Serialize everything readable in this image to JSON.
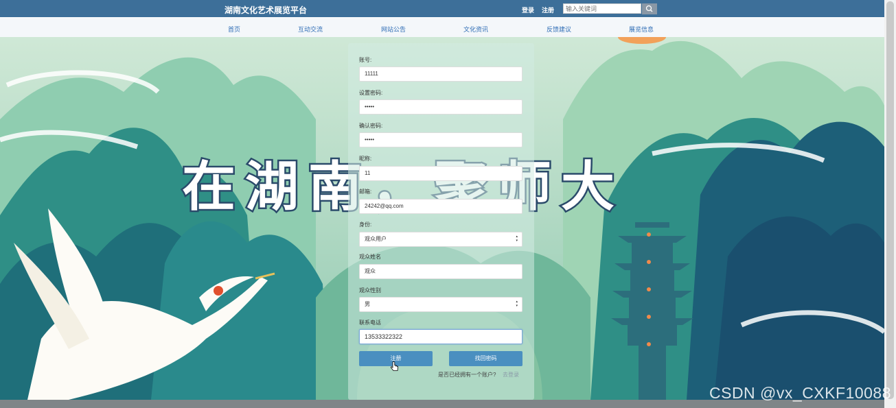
{
  "header": {
    "site_title": "湖南文化艺术展览平台",
    "login_label": "登录",
    "register_label": "注册",
    "search_placeholder": "输入关键词",
    "search_icon": "search-icon"
  },
  "nav": {
    "items": [
      {
        "label": "首页"
      },
      {
        "label": "互动交流"
      },
      {
        "label": "网站公告"
      },
      {
        "label": "文化资讯"
      },
      {
        "label": "反馈建议"
      },
      {
        "label": "展览信息"
      }
    ]
  },
  "banner": {
    "slogan": "在湖南，聚师大"
  },
  "form": {
    "fields": [
      {
        "label": "账号:",
        "value": "11111"
      },
      {
        "label": "设置密码:",
        "value": "•••••"
      },
      {
        "label": "确认密码:",
        "value": "•••••"
      },
      {
        "label": "昵称:",
        "value": "11"
      },
      {
        "label": "邮箱:",
        "value": "24242@qq.com"
      },
      {
        "label": "身份:",
        "value": "观众用户"
      },
      {
        "label": "观众姓名",
        "value": "观众"
      },
      {
        "label": "观众性别",
        "value": "男"
      },
      {
        "label": "联系电话",
        "value": "13533322322"
      }
    ],
    "register_button": "注册",
    "find_password_button": "找回密码",
    "login_hint": "是否已经拥有一个账户?",
    "login_link": "去登录"
  },
  "watermark": "CSDN @vx_CXKF10088",
  "colors": {
    "topbar": "#3d6f99",
    "nav_text": "#2f6db5",
    "button": "#4a8fc0"
  }
}
